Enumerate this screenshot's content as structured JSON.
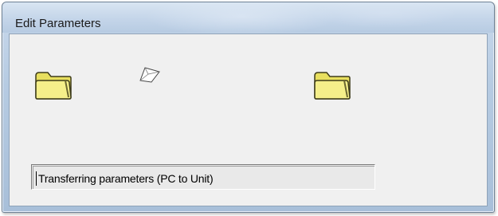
{
  "window": {
    "title": "Edit Parameters"
  },
  "icons": {
    "source": "folder-icon",
    "transfer": "flying-paper-icon",
    "destination": "folder-icon"
  },
  "status": {
    "text": "Transferring parameters (PC to Unit)"
  },
  "colors": {
    "folder_fill": "#f2ec7c",
    "folder_stroke": "#3d3b1a",
    "client_bg": "#f0f0f0",
    "titlebar": "#c4d5e9"
  }
}
